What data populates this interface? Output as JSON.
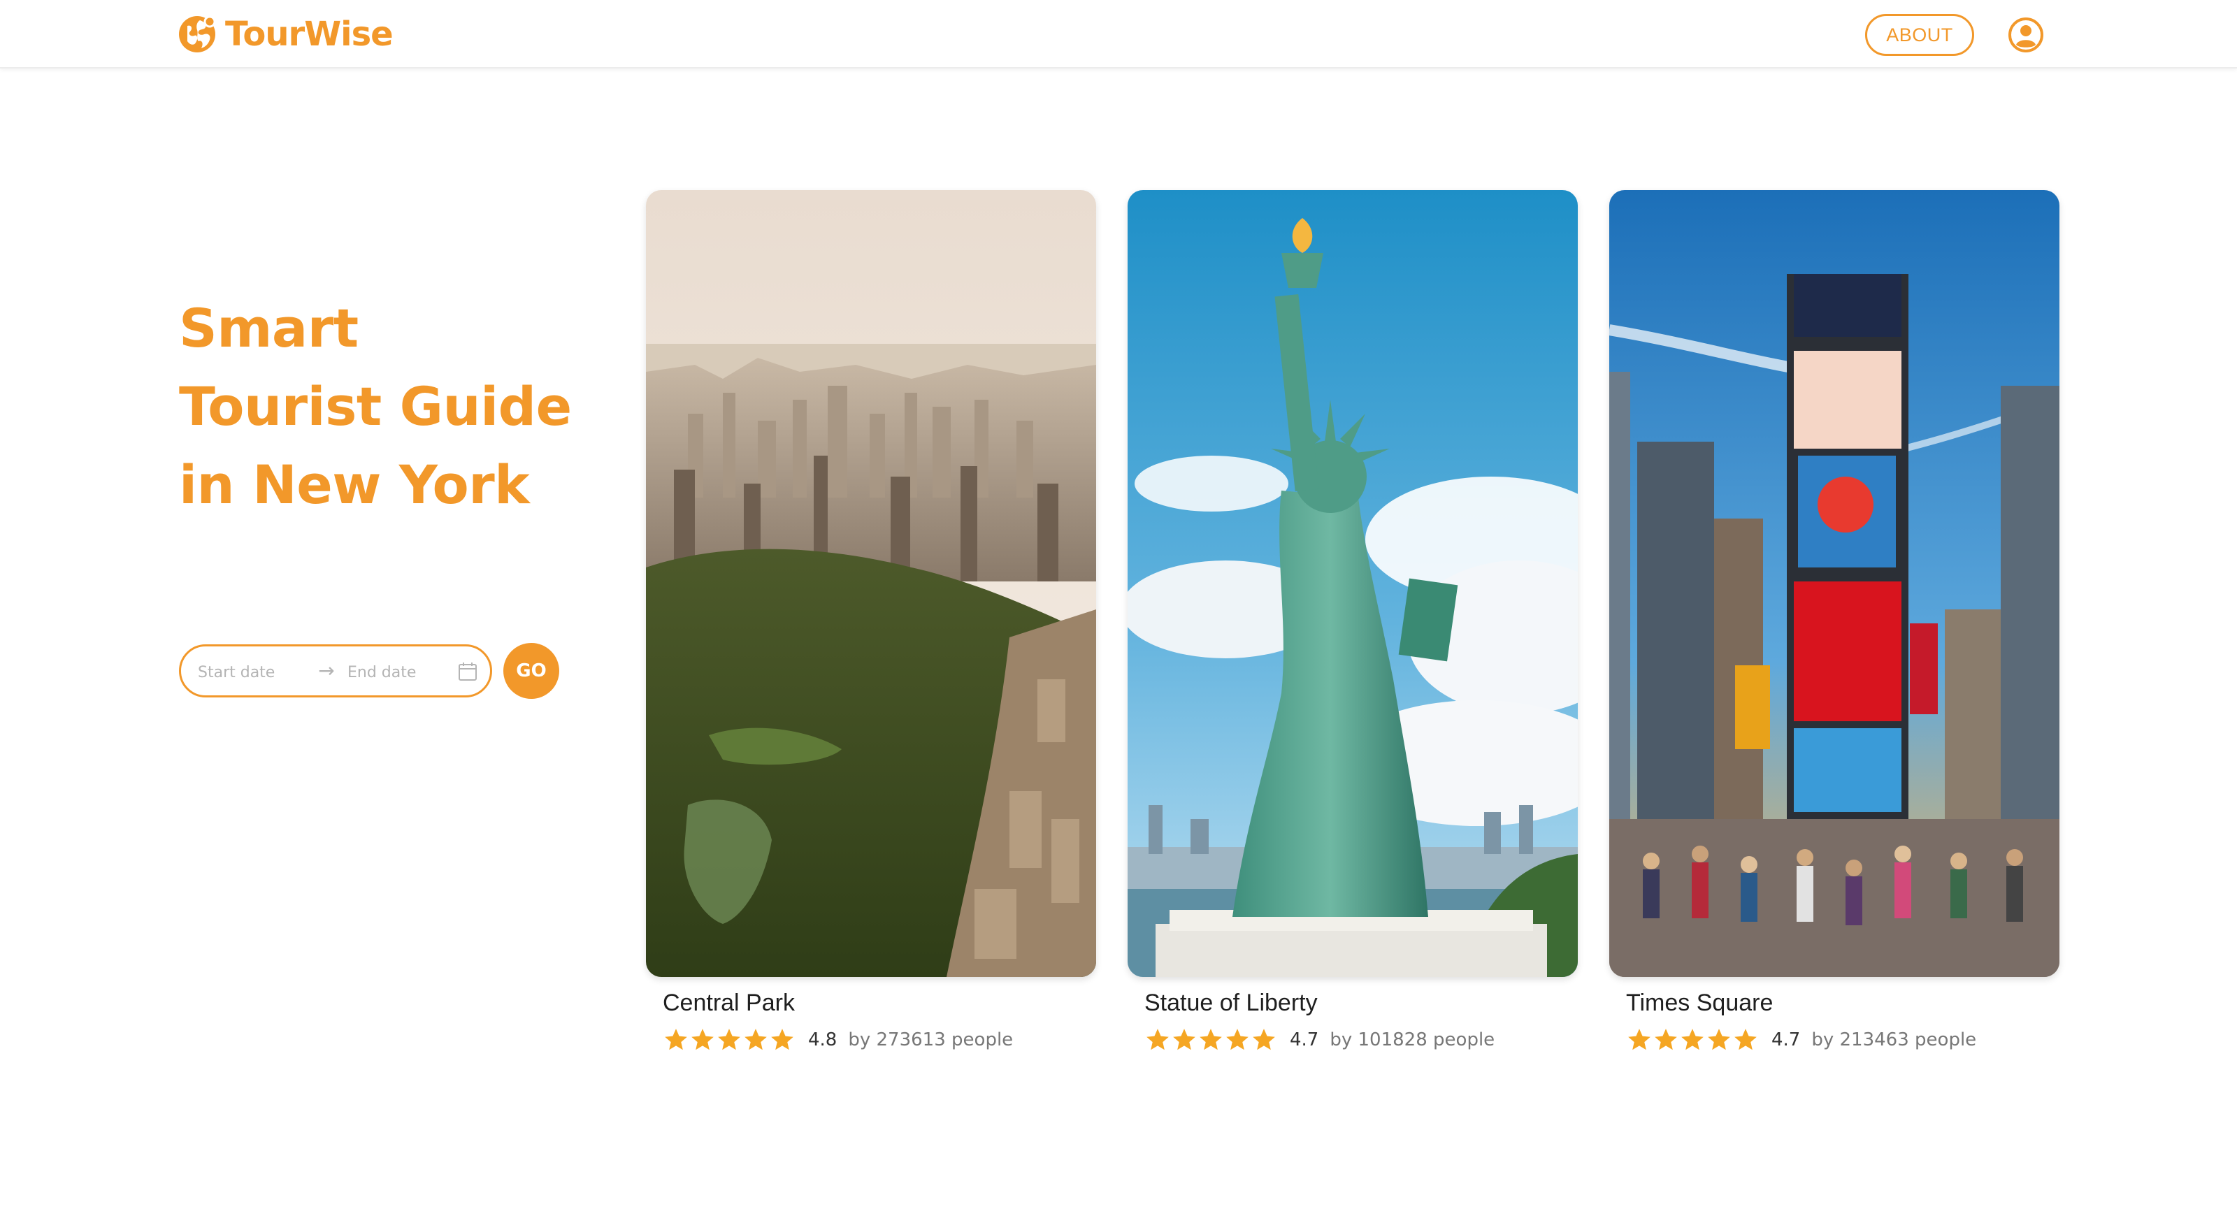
{
  "header": {
    "logo_text": "TourWise",
    "about_label": "ABOUT",
    "logo_icon": "globe-icon",
    "profile_icon": "user-circle-icon"
  },
  "hero": {
    "line1": "Smart",
    "line2": "Tourist Guide",
    "line3": "in New York"
  },
  "date_range": {
    "start_placeholder": "Start date",
    "end_placeholder": "End date",
    "arrow_icon": "arrow-right-icon",
    "calendar_icon": "calendar-icon"
  },
  "go_label": "GO",
  "colors": {
    "accent": "#f2982a",
    "star": "#f5a623"
  },
  "attractions": [
    {
      "name": "Central Park",
      "rating": "4.8",
      "stars": 5,
      "count_text": "by 273613 people",
      "image": "aerial-view-central-park"
    },
    {
      "name": "Statue of Liberty",
      "rating": "4.7",
      "stars": 5,
      "count_text": "by 101828 people",
      "image": "statue-of-liberty-photo"
    },
    {
      "name": "Times Square",
      "rating": "4.7",
      "stars": 5,
      "count_text": "by 213463 people",
      "image": "times-square-photo"
    }
  ]
}
